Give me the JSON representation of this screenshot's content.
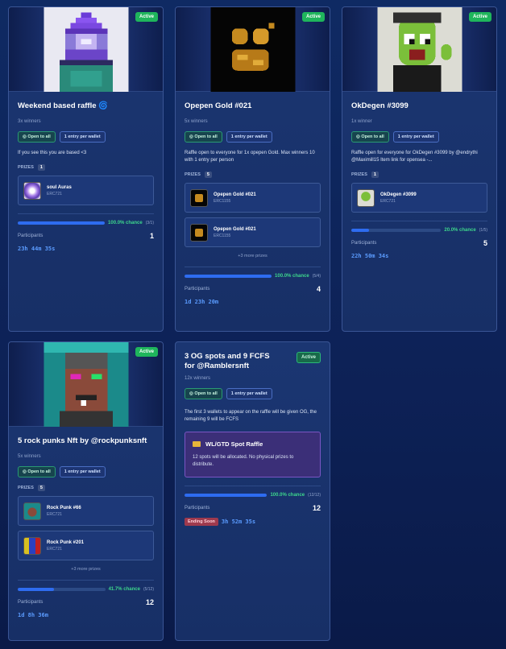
{
  "cards": [
    {
      "status": "Active",
      "title": "Weekend based raffle 🌀",
      "winners": "3x winners",
      "tag_open": "Open to all",
      "tag_entry": "1 entry per wallet",
      "description": "If you see this you are based <3",
      "prizes_label": "PRIZES",
      "prizes_count": "1",
      "prizes": [
        {
          "name": "soul Auras",
          "type": "ERC721"
        }
      ],
      "chance": "100.0% chance",
      "chance_frac": "(3/1)",
      "chance_fill": 1.0,
      "participants_label": "Participants",
      "participants": "1",
      "timer": "23h 44m 35s"
    },
    {
      "status": "Active",
      "title": "Opepen Gold #021",
      "winners": "5x winners",
      "tag_open": "Open to all",
      "tag_entry": "1 entry per wallet",
      "description": "Raffle open to everyone for 1x opepen Gold. Max winners 10 with 1 entry per person",
      "prizes_label": "PRIZES",
      "prizes_count": "5",
      "prizes": [
        {
          "name": "Opepen Gold #021",
          "type": "ERC1155"
        },
        {
          "name": "Opepen Gold #021",
          "type": "ERC1155"
        }
      ],
      "more": "+3 more prizes",
      "chance": "100.0% chance",
      "chance_frac": "(5/4)",
      "chance_fill": 1.0,
      "participants_label": "Participants",
      "participants": "4",
      "timer": "1d 23h 20m"
    },
    {
      "status": "Active",
      "title": "OkDegen #3099",
      "winners": "1x winner",
      "tag_open": "Open to all",
      "tag_entry": "1 entry per wallet",
      "description": "Raffle open for everyone for OkDegen #3099 by @endrythi @Maximill15 Item link for opensea -...",
      "prizes_label": "PRIZES",
      "prizes_count": "1",
      "prizes": [
        {
          "name": "OkDegen #3099",
          "type": "ERC721"
        }
      ],
      "chance": "20.0% chance",
      "chance_frac": "(1/5)",
      "chance_fill": 0.2,
      "participants_label": "Participants",
      "participants": "5",
      "timer": "22h 50m 34s"
    },
    {
      "status": "Active",
      "title": "5 rock punks Nft by @rockpunksnft",
      "winners": "5x winners",
      "tag_open": "Open to all",
      "tag_entry": "1 entry per wallet",
      "prizes_label": "PRIZES",
      "prizes_count": "5",
      "prizes": [
        {
          "name": "Rock Punk #66",
          "type": "ERC721"
        },
        {
          "name": "Rock Punk #201",
          "type": "ERC721"
        }
      ],
      "more": "+3 more prizes",
      "chance": "41.7% chance",
      "chance_frac": "(5/12)",
      "chance_fill": 0.417,
      "participants_label": "Participants",
      "participants": "12",
      "timer": "1d 8h 36m"
    },
    {
      "status": "Active",
      "title": "3 OG spots and 9 FCFS for @Ramblersnft",
      "winners": "12x winners",
      "tag_open": "Open to all",
      "tag_entry": "1 entry per wallet",
      "description": "The first 3 wallets to appear on the raffle will be given OG, the remaining 9 will be FCFS",
      "wl_title": "WL/GTD Spot Raffle",
      "wl_text": "12 spots will be allocated. No physical prizes to distribute.",
      "chance": "100.0% chance",
      "chance_frac": "(12/12)",
      "chance_fill": 1.0,
      "participants_label": "Participants",
      "participants": "12",
      "ending": "Ending Soon",
      "timer": "3h 52m 35s"
    }
  ],
  "colors": {
    "accent": "#2e6cf0",
    "active": "#1fb55c",
    "chance": "#3dd68c",
    "timer": "#5b9cff"
  }
}
